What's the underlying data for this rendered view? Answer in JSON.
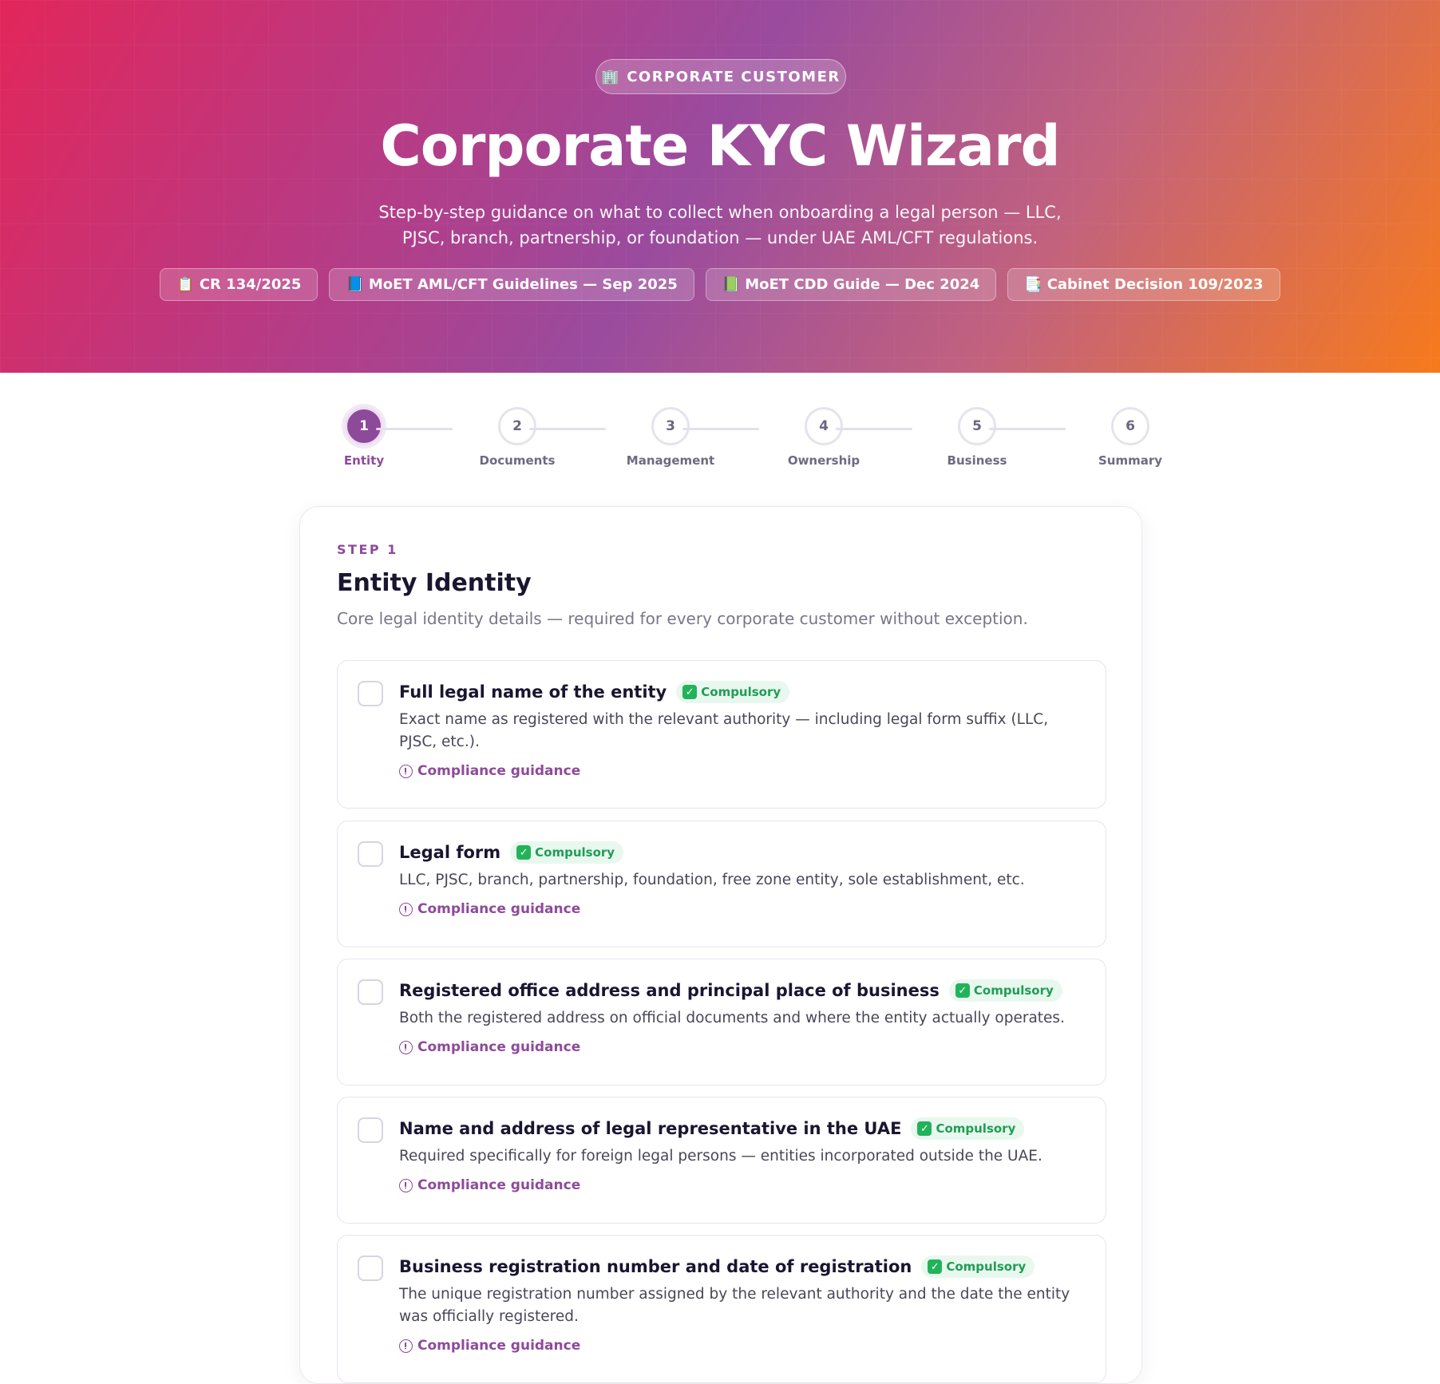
{
  "hero": {
    "pill_icon": "🏢",
    "pill_label": "CORPORATE CUSTOMER",
    "title": "Corporate KYC Wizard",
    "subtitle": "Step-by-step guidance on what to collect when onboarding a legal person — LLC, PJSC, branch, partnership, or foundation — under UAE AML/CFT regulations.",
    "references": [
      {
        "icon": "📋",
        "label": "CR 134/2025"
      },
      {
        "icon": "📘",
        "label": "MoET AML/CFT Guidelines — Sep 2025"
      },
      {
        "icon": "📗",
        "label": "MoET CDD Guide — Dec 2024"
      },
      {
        "icon": "📑",
        "label": "Cabinet Decision 109/2023"
      }
    ],
    "colors": {
      "gradient_start": "#e2265a",
      "gradient_mid": "#9a4b9e",
      "gradient_end": "#f77a1c"
    }
  },
  "stepper": {
    "current": 1,
    "steps": [
      {
        "number": "1",
        "label": "Entity"
      },
      {
        "number": "2",
        "label": "Documents"
      },
      {
        "number": "3",
        "label": "Management"
      },
      {
        "number": "4",
        "label": "Ownership"
      },
      {
        "number": "5",
        "label": "Business"
      },
      {
        "number": "6",
        "label": "Summary"
      }
    ]
  },
  "section": {
    "eyebrow": "STEP 1",
    "title": "Entity Identity",
    "description": "Core legal identity details — required for every corporate customer without exception."
  },
  "items": [
    {
      "title": "Full legal name of the entity",
      "badge": "Compulsory",
      "description": "Exact name as registered with the relevant authority — including legal form suffix (LLC, PJSC, etc.).",
      "guidance": "Compliance guidance",
      "checked": false
    },
    {
      "title": "Legal form",
      "badge": "Compulsory",
      "description": "LLC, PJSC, branch, partnership, foundation, free zone entity, sole establishment, etc.",
      "guidance": "Compliance guidance",
      "checked": false
    },
    {
      "title": "Registered office address and principal place of business",
      "badge": "Compulsory",
      "description": "Both the registered address on official documents and where the entity actually operates.",
      "guidance": "Compliance guidance",
      "checked": false
    },
    {
      "title": "Name and address of legal representative in the UAE",
      "badge": "Compulsory",
      "description": "Required specifically for foreign legal persons — entities incorporated outside the UAE.",
      "guidance": "Compliance guidance",
      "checked": false
    },
    {
      "title": "Business registration number and date of registration",
      "badge": "Compulsory",
      "description": "The unique registration number assigned by the relevant authority and the date the entity was officially registered.",
      "guidance": "Compliance guidance",
      "checked": false
    }
  ],
  "colors": {
    "accent": "#8e4a9a",
    "compulsory_green": "#1f9d55"
  }
}
